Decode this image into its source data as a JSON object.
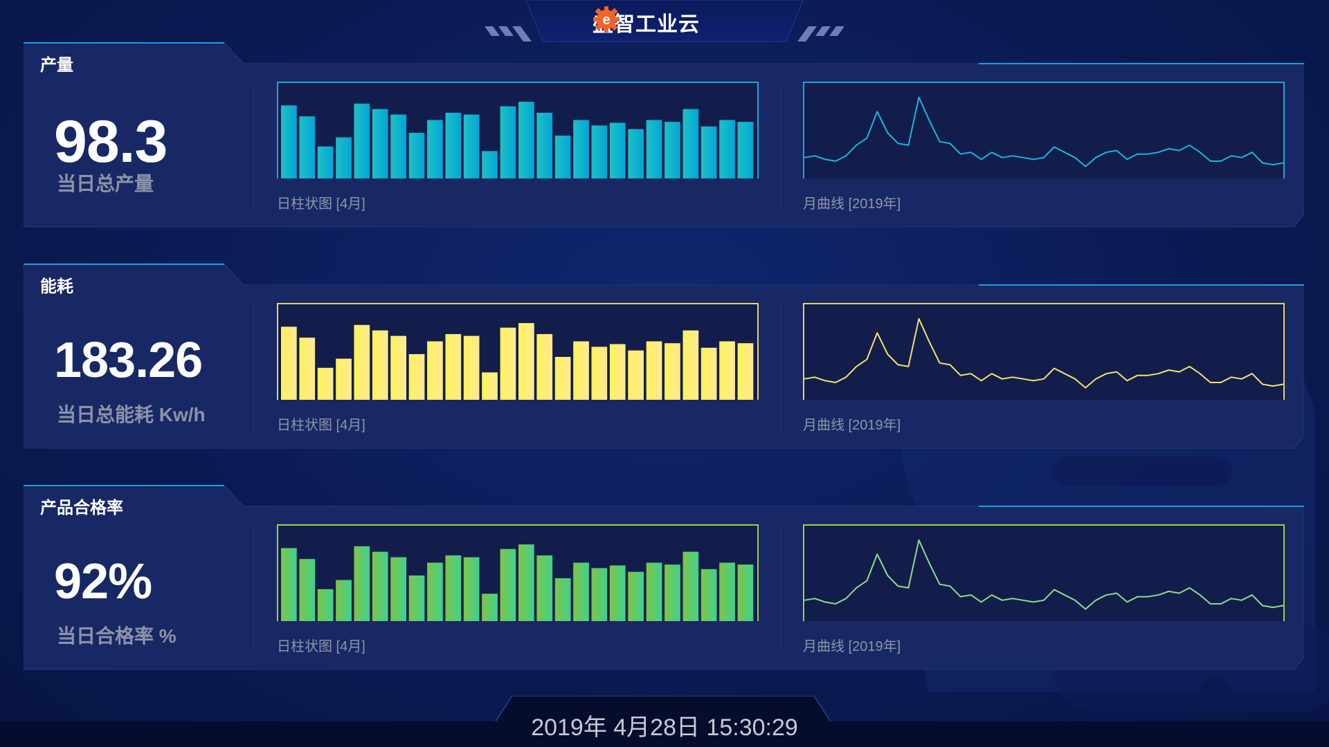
{
  "header": {
    "title": "盛智工业云",
    "logo_icon": "gear-logo-icon"
  },
  "colors": {
    "cyan_top": "#1fc0c4",
    "cyan_bottom": "#00a6d8",
    "yellow_top": "#fff25a",
    "yellow_bottom": "#ffe994",
    "green_top": "#7ec545",
    "green_bottom": "#3fd190",
    "line_cyan": "#1ab6dc",
    "line_yellow": "#f5e46a",
    "line_green": "#8fde8a",
    "panel_bg": "#172764",
    "accent": "#0fa0e8"
  },
  "panels": [
    {
      "title": "产量",
      "value": "98.3",
      "label": "当日总产量",
      "bar_caption": "日柱状图 [4月]",
      "line_caption": "月曲线 [2019年]"
    },
    {
      "title": "能耗",
      "value": "183.26",
      "label": "当日总能耗 Kw/h",
      "bar_caption": "日柱状图 [4月]",
      "line_caption": "月曲线 [2019年]"
    },
    {
      "title": "产品合格率",
      "value": "92%",
      "label": "当日合格率 %",
      "bar_caption": "日柱状图 [4月]",
      "line_caption": "月曲线 [2019年]"
    }
  ],
  "chart_data": [
    {
      "type": "bar",
      "series": [
        {
          "values": [
            80,
            68,
            35,
            45,
            82,
            76,
            70,
            50,
            64,
            72,
            70,
            30,
            79,
            84,
            72,
            47,
            64,
            58,
            61,
            54,
            64,
            62,
            76,
            57,
            64,
            62
          ]
        }
      ],
      "ylim": [
        0,
        100
      ]
    },
    {
      "type": "line",
      "series": [
        {
          "values": [
            22,
            24,
            20,
            18,
            24,
            36,
            44,
            74,
            50,
            38,
            36,
            90,
            64,
            40,
            38,
            26,
            28,
            20,
            28,
            22,
            24,
            22,
            20,
            22,
            34,
            28,
            22,
            12,
            22,
            28,
            30,
            20,
            26,
            26,
            28,
            32,
            30,
            36,
            28,
            18,
            18,
            24,
            22,
            28,
            16,
            14,
            16
          ]
        }
      ],
      "ylim": [
        0,
        100
      ]
    },
    {
      "type": "bar",
      "series": [
        {
          "values": [
            80,
            68,
            35,
            45,
            82,
            76,
            70,
            50,
            64,
            72,
            70,
            30,
            79,
            84,
            72,
            47,
            64,
            58,
            61,
            54,
            64,
            62,
            76,
            57,
            64,
            62
          ]
        }
      ],
      "ylim": [
        0,
        100
      ]
    },
    {
      "type": "line",
      "series": [
        {
          "values": [
            22,
            24,
            20,
            18,
            24,
            36,
            44,
            74,
            50,
            38,
            36,
            90,
            64,
            40,
            38,
            26,
            28,
            20,
            28,
            22,
            24,
            22,
            20,
            22,
            34,
            28,
            22,
            12,
            22,
            28,
            30,
            20,
            26,
            26,
            28,
            32,
            30,
            36,
            28,
            18,
            18,
            24,
            22,
            28,
            16,
            14,
            16
          ]
        }
      ],
      "ylim": [
        0,
        100
      ]
    },
    {
      "type": "bar",
      "series": [
        {
          "values": [
            80,
            68,
            35,
            45,
            82,
            76,
            70,
            50,
            64,
            72,
            70,
            30,
            79,
            84,
            72,
            47,
            64,
            58,
            61,
            54,
            64,
            62,
            76,
            57,
            64,
            62
          ]
        }
      ],
      "ylim": [
        0,
        100
      ]
    },
    {
      "type": "line",
      "series": [
        {
          "values": [
            22,
            24,
            20,
            18,
            24,
            36,
            44,
            74,
            50,
            38,
            36,
            90,
            64,
            40,
            38,
            26,
            28,
            20,
            28,
            22,
            24,
            22,
            20,
            22,
            34,
            28,
            22,
            12,
            22,
            28,
            30,
            20,
            26,
            26,
            28,
            32,
            30,
            36,
            28,
            18,
            18,
            24,
            22,
            28,
            16,
            14,
            16
          ]
        }
      ],
      "ylim": [
        0,
        100
      ]
    }
  ],
  "footer": {
    "datetime": "2019年 4月28日 15:30:29"
  }
}
